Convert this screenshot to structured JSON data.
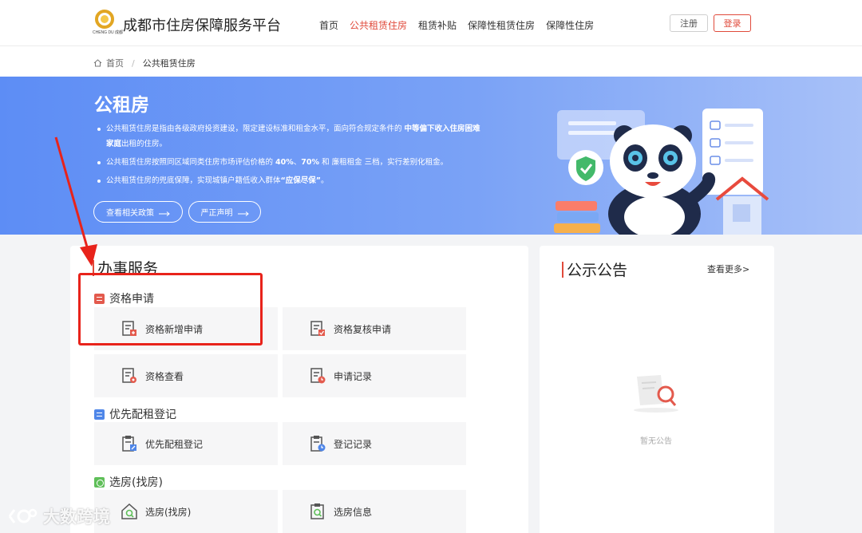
{
  "header": {
    "logo_text": "CHENG DU 成都",
    "site_title": "成都市住房保障服务平台",
    "nav": [
      {
        "label": "首页",
        "active": false
      },
      {
        "label": "公共租赁住房",
        "active": true
      },
      {
        "label": "租赁补贴",
        "active": false
      },
      {
        "label": "保障性租赁住房",
        "active": false
      },
      {
        "label": "保障性住房",
        "active": false
      }
    ],
    "register_label": "注册",
    "login_label": "登录"
  },
  "breadcrumb": {
    "home": "首页",
    "separator": "/",
    "current": "公共租赁住房"
  },
  "banner": {
    "title": "公租房",
    "bullets": [
      {
        "pre": "公共租赁住房是指由各级政府投资建设，限定建设标准和租金水平，面向符合规定条件的 ",
        "bold1": "中等偏下收入住房困难家庭",
        "mid": "",
        "bold2": "",
        "post": "出租的住房。"
      },
      {
        "pre": "公共租赁住房按照同区域同类住房市场评估价格的 ",
        "bold1": "40%",
        "mid": "、",
        "bold2": "70%",
        "post": " 和 廉租租金 三档，实行差别化租金。"
      },
      {
        "pre": "公共租赁住房的兜底保障，实现城镇户籍低收入群体",
        "bold1": "“应保尽保”",
        "mid": "",
        "bold2": "",
        "post": "。"
      }
    ],
    "btn_policy": "查看相关政策",
    "btn_statement": "严正声明"
  },
  "services": {
    "title": "办事服务",
    "groups": [
      {
        "title": "资格申请",
        "items": [
          "资格新增申请",
          "资格复核申请",
          "资格查看",
          "申请记录"
        ]
      },
      {
        "title": "优先配租登记",
        "items": [
          "优先配租登记",
          "登记记录"
        ]
      },
      {
        "title": "选房(找房)",
        "items": [
          "选房(找房)",
          "选房信息"
        ]
      }
    ]
  },
  "notices": {
    "title": "公示公告",
    "more": "查看更多>",
    "empty": "暂无公告"
  },
  "watermark": "大数跨境",
  "colors": {
    "accent": "#e04a3b",
    "banner_start": "#5d8df5",
    "annotation": "#e8231b"
  }
}
